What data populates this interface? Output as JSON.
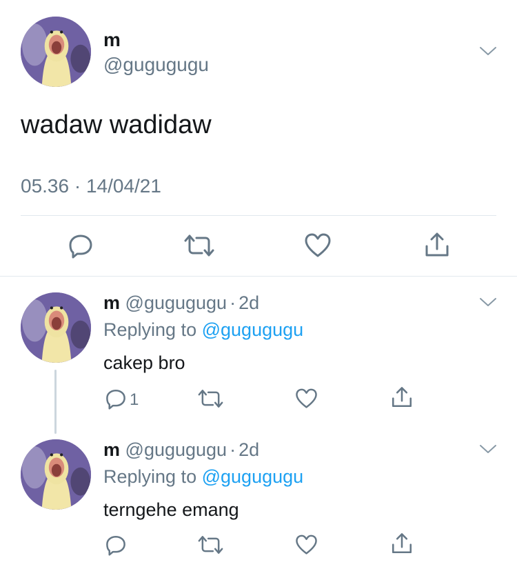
{
  "main_tweet": {
    "display_name": "m",
    "handle": "@gugugugu",
    "text": "wadaw wadidaw",
    "timestamp": "05.36 · 14/04/21"
  },
  "replies": [
    {
      "display_name": "m",
      "handle": "@gugugugu",
      "separator": "·",
      "age": "2d",
      "replying_prefix": "Replying to",
      "replying_to": "@gugugugu",
      "text": "cakep bro",
      "reply_count": "1"
    },
    {
      "display_name": "m",
      "handle": "@gugugugu",
      "separator": "·",
      "age": "2d",
      "replying_prefix": "Replying to",
      "replying_to": "@gugugugu",
      "text": "terngehe emang",
      "reply_count": ""
    }
  ],
  "icons": {
    "reply": "reply-icon",
    "retweet": "retweet-icon",
    "like": "heart-icon",
    "share": "share-icon",
    "menu": "chevron-down-icon"
  },
  "colors": {
    "text": "#14171a",
    "muted": "#657786",
    "link": "#1da1f2",
    "divider": "#e1e8ed"
  }
}
